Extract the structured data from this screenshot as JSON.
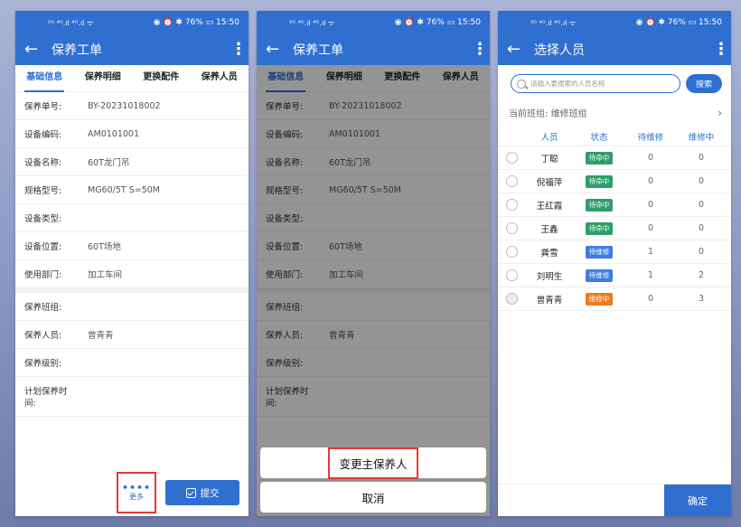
{
  "status_bar": {
    "left": "⁵ᴳ ⁴ᴳ.ıl ⁴ᴳ.ıl ᯤ",
    "right": "◉ ⏰ ✱ 76% ▭ 15:50"
  },
  "order_screen": {
    "title": "保养工单",
    "tabs": [
      "基础信息",
      "保养明细",
      "更换配件",
      "保养人员"
    ],
    "fields": [
      {
        "label": "保养单号:",
        "value": "BY-20231018002"
      },
      {
        "label": "设备编码:",
        "value": "AM0101001"
      },
      {
        "label": "设备名称:",
        "value": "60T龙门吊"
      },
      {
        "label": "规格型号:",
        "value": "MG60/5T S=50M"
      },
      {
        "label": "设备类型:",
        "value": ""
      },
      {
        "label": "设备位置:",
        "value": "60T场地"
      },
      {
        "label": "使用部门:",
        "value": "加工车间"
      }
    ],
    "fields2": [
      {
        "label": "保养班组:",
        "value": ""
      },
      {
        "label": "保养人员:",
        "value": "曾青青"
      },
      {
        "label": "保养级别:",
        "value": ""
      },
      {
        "label": "计划保养时间:",
        "value": ""
      }
    ],
    "more_label": "更多",
    "submit_label": "提交"
  },
  "action_sheet": {
    "change_main_label": "变更主保养人",
    "cancel_label": "取消"
  },
  "select_screen": {
    "title": "选择人员",
    "search_placeholder": "请输入要搜索的人员名称",
    "search_label": "搜索",
    "group_label": "当前班组:",
    "group_value": "维修班组",
    "columns": [
      "人员",
      "状态",
      "待维修",
      "维修中"
    ],
    "rows": [
      {
        "name": "丁聪",
        "status": "待命中",
        "pending": "0",
        "in_progress": "0",
        "status_color": "#2e9e6a"
      },
      {
        "name": "倪福萍",
        "status": "待命中",
        "pending": "0",
        "in_progress": "0",
        "status_color": "#2e9e6a"
      },
      {
        "name": "王红霞",
        "status": "待命中",
        "pending": "0",
        "in_progress": "0",
        "status_color": "#2e9e6a"
      },
      {
        "name": "王鑫",
        "status": "待命中",
        "pending": "0",
        "in_progress": "0",
        "status_color": "#2e9e6a"
      },
      {
        "name": "龚雪",
        "status": "待维修",
        "pending": "1",
        "in_progress": "0",
        "status_color": "#3d7de0"
      },
      {
        "name": "刘明生",
        "status": "待维修",
        "pending": "1",
        "in_progress": "2",
        "status_color": "#3d7de0"
      },
      {
        "name": "曾青青",
        "status": "维修中",
        "pending": "0",
        "in_progress": "3",
        "status_color": "#f07a1a"
      }
    ],
    "confirm_label": "确定"
  },
  "colors": {
    "primary": "#2f6fd0",
    "highlight": "#e53935"
  }
}
